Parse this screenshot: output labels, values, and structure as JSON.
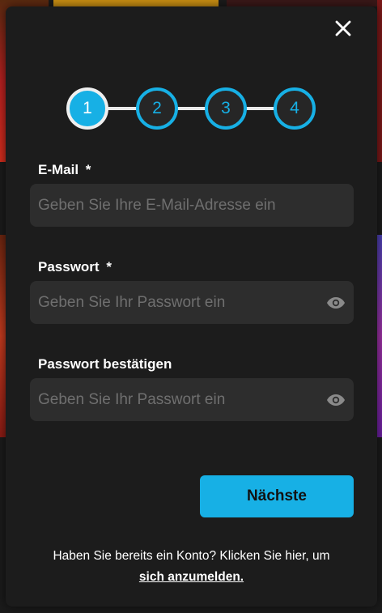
{
  "colors": {
    "accent": "#17b0e5",
    "modal_bg": "#1c1c1c",
    "field_bg": "#2d2d2d"
  },
  "stepper": {
    "steps": [
      "1",
      "2",
      "3",
      "4"
    ],
    "current": 1
  },
  "form": {
    "email": {
      "label": "E-Mail",
      "required_mark": "*",
      "placeholder": "Geben Sie Ihre E-Mail-Adresse ein"
    },
    "password": {
      "label": "Passwort",
      "required_mark": "*",
      "placeholder": "Geben Sie Ihr Passwort ein"
    },
    "confirm": {
      "label": "Passwort bestätigen",
      "placeholder": "Geben Sie Ihr Passwort ein"
    }
  },
  "next_label": "Nächste",
  "footer": {
    "text": "Haben Sie bereits ein Konto? Klicken Sie hier, um",
    "link": "sich anzumelden."
  },
  "icons": {
    "close": "close-icon",
    "eye": "eye-icon"
  }
}
